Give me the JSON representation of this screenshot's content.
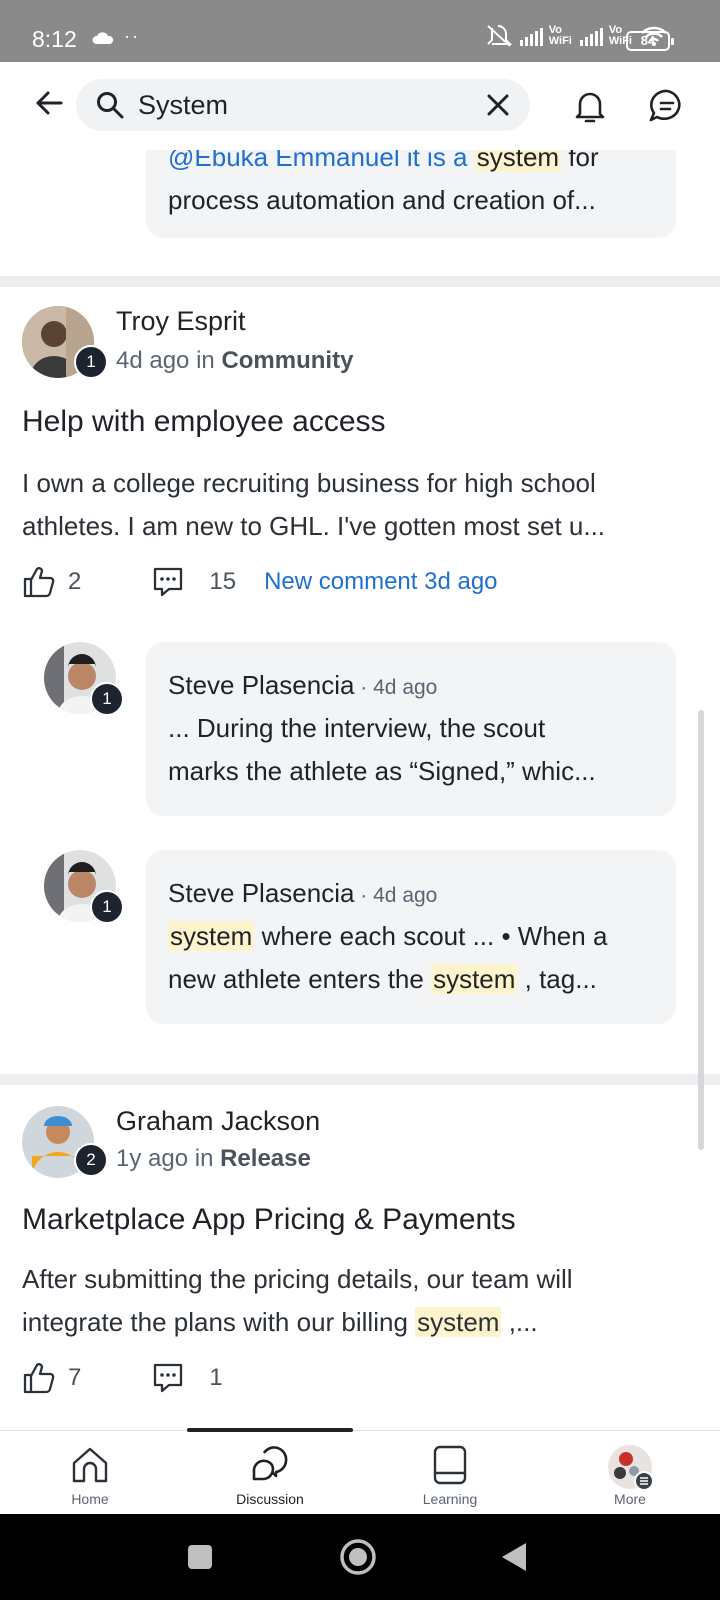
{
  "status_bar": {
    "time": "8:12",
    "dots": "··",
    "net1": "Vo\nWiFi",
    "net2": "Vo\nWiFi",
    "battery": "84"
  },
  "search": {
    "value": "System",
    "placeholder": "Search"
  },
  "feed": {
    "top_snippet": {
      "line1_start": "@Ebuka Emmanuel it is a ",
      "line1_hl": "system",
      "line1_end": " for",
      "line2": "process automation and creation of..."
    },
    "posts": [
      {
        "author": "Troy Esprit",
        "level": "1",
        "time": "4d ago",
        "in_word": "in",
        "category": "Community",
        "title": "Help with employee access",
        "body_line1": "I own a college recruiting business for high school",
        "body_line2": "athletes. I am new to GHL. I've gotten most set u...",
        "likes": "2",
        "comments": "15",
        "new_comment": "New comment 3d ago",
        "replies": [
          {
            "author": "Steve Plasencia",
            "level": "1",
            "time": "4d ago",
            "line1": "... During the interview, the scout",
            "line2": "marks the athlete as “Signed,” whic..."
          },
          {
            "author": "Steve Plasencia",
            "level": "1",
            "time": "4d ago",
            "line1_hl": "system",
            "line1_rest": " where each scout ... • When a",
            "line2_start": "new athlete enters the ",
            "line2_hl": "system",
            "line2_end": " , tag..."
          }
        ]
      },
      {
        "author": "Graham Jackson",
        "level": "2",
        "time": "1y ago",
        "in_word": "in",
        "category": "Release",
        "title": "Marketplace App Pricing & Payments",
        "body_line1": "After submitting the pricing details, our team will",
        "body_line2_start": "integrate the plans with our billing ",
        "body_line2_hl": "system",
        "body_line2_end": " ,...",
        "likes": "7",
        "comments": "1"
      }
    ]
  },
  "bottom_nav": [
    {
      "label": "Home",
      "icon": "home-icon"
    },
    {
      "label": "Discussion",
      "icon": "discussion-icon",
      "active": true
    },
    {
      "label": "Learning",
      "icon": "learning-icon"
    },
    {
      "label": "More",
      "icon": "avatar-icon"
    }
  ],
  "colors": {
    "accent": "#1f6fd1",
    "highlight": "#fdf3cd",
    "bubble": "#f3f4f6",
    "badge": "#1c2430"
  }
}
